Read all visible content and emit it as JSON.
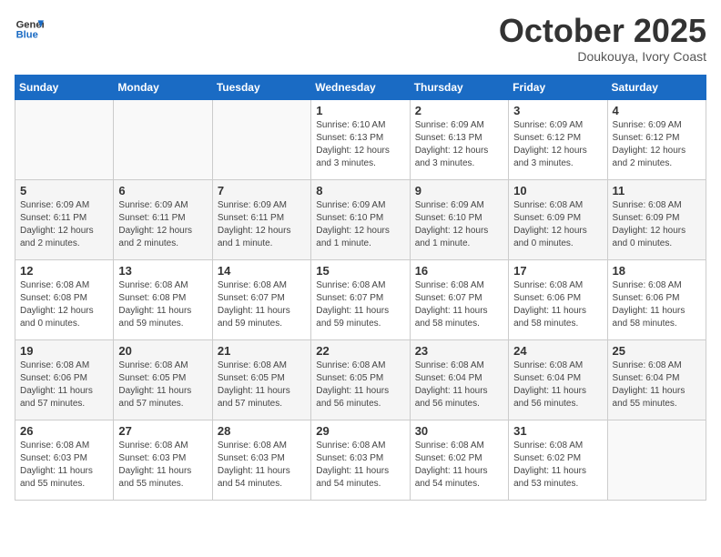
{
  "header": {
    "logo_line1": "General",
    "logo_line2": "Blue",
    "month": "October 2025",
    "location": "Doukouya, Ivory Coast"
  },
  "weekdays": [
    "Sunday",
    "Monday",
    "Tuesday",
    "Wednesday",
    "Thursday",
    "Friday",
    "Saturday"
  ],
  "weeks": [
    [
      {
        "day": "",
        "info": ""
      },
      {
        "day": "",
        "info": ""
      },
      {
        "day": "",
        "info": ""
      },
      {
        "day": "1",
        "info": "Sunrise: 6:10 AM\nSunset: 6:13 PM\nDaylight: 12 hours\nand 3 minutes."
      },
      {
        "day": "2",
        "info": "Sunrise: 6:09 AM\nSunset: 6:13 PM\nDaylight: 12 hours\nand 3 minutes."
      },
      {
        "day": "3",
        "info": "Sunrise: 6:09 AM\nSunset: 6:12 PM\nDaylight: 12 hours\nand 3 minutes."
      },
      {
        "day": "4",
        "info": "Sunrise: 6:09 AM\nSunset: 6:12 PM\nDaylight: 12 hours\nand 2 minutes."
      }
    ],
    [
      {
        "day": "5",
        "info": "Sunrise: 6:09 AM\nSunset: 6:11 PM\nDaylight: 12 hours\nand 2 minutes."
      },
      {
        "day": "6",
        "info": "Sunrise: 6:09 AM\nSunset: 6:11 PM\nDaylight: 12 hours\nand 2 minutes."
      },
      {
        "day": "7",
        "info": "Sunrise: 6:09 AM\nSunset: 6:11 PM\nDaylight: 12 hours\nand 1 minute."
      },
      {
        "day": "8",
        "info": "Sunrise: 6:09 AM\nSunset: 6:10 PM\nDaylight: 12 hours\nand 1 minute."
      },
      {
        "day": "9",
        "info": "Sunrise: 6:09 AM\nSunset: 6:10 PM\nDaylight: 12 hours\nand 1 minute."
      },
      {
        "day": "10",
        "info": "Sunrise: 6:08 AM\nSunset: 6:09 PM\nDaylight: 12 hours\nand 0 minutes."
      },
      {
        "day": "11",
        "info": "Sunrise: 6:08 AM\nSunset: 6:09 PM\nDaylight: 12 hours\nand 0 minutes."
      }
    ],
    [
      {
        "day": "12",
        "info": "Sunrise: 6:08 AM\nSunset: 6:08 PM\nDaylight: 12 hours\nand 0 minutes."
      },
      {
        "day": "13",
        "info": "Sunrise: 6:08 AM\nSunset: 6:08 PM\nDaylight: 11 hours\nand 59 minutes."
      },
      {
        "day": "14",
        "info": "Sunrise: 6:08 AM\nSunset: 6:07 PM\nDaylight: 11 hours\nand 59 minutes."
      },
      {
        "day": "15",
        "info": "Sunrise: 6:08 AM\nSunset: 6:07 PM\nDaylight: 11 hours\nand 59 minutes."
      },
      {
        "day": "16",
        "info": "Sunrise: 6:08 AM\nSunset: 6:07 PM\nDaylight: 11 hours\nand 58 minutes."
      },
      {
        "day": "17",
        "info": "Sunrise: 6:08 AM\nSunset: 6:06 PM\nDaylight: 11 hours\nand 58 minutes."
      },
      {
        "day": "18",
        "info": "Sunrise: 6:08 AM\nSunset: 6:06 PM\nDaylight: 11 hours\nand 58 minutes."
      }
    ],
    [
      {
        "day": "19",
        "info": "Sunrise: 6:08 AM\nSunset: 6:06 PM\nDaylight: 11 hours\nand 57 minutes."
      },
      {
        "day": "20",
        "info": "Sunrise: 6:08 AM\nSunset: 6:05 PM\nDaylight: 11 hours\nand 57 minutes."
      },
      {
        "day": "21",
        "info": "Sunrise: 6:08 AM\nSunset: 6:05 PM\nDaylight: 11 hours\nand 57 minutes."
      },
      {
        "day": "22",
        "info": "Sunrise: 6:08 AM\nSunset: 6:05 PM\nDaylight: 11 hours\nand 56 minutes."
      },
      {
        "day": "23",
        "info": "Sunrise: 6:08 AM\nSunset: 6:04 PM\nDaylight: 11 hours\nand 56 minutes."
      },
      {
        "day": "24",
        "info": "Sunrise: 6:08 AM\nSunset: 6:04 PM\nDaylight: 11 hours\nand 56 minutes."
      },
      {
        "day": "25",
        "info": "Sunrise: 6:08 AM\nSunset: 6:04 PM\nDaylight: 11 hours\nand 55 minutes."
      }
    ],
    [
      {
        "day": "26",
        "info": "Sunrise: 6:08 AM\nSunset: 6:03 PM\nDaylight: 11 hours\nand 55 minutes."
      },
      {
        "day": "27",
        "info": "Sunrise: 6:08 AM\nSunset: 6:03 PM\nDaylight: 11 hours\nand 55 minutes."
      },
      {
        "day": "28",
        "info": "Sunrise: 6:08 AM\nSunset: 6:03 PM\nDaylight: 11 hours\nand 54 minutes."
      },
      {
        "day": "29",
        "info": "Sunrise: 6:08 AM\nSunset: 6:03 PM\nDaylight: 11 hours\nand 54 minutes."
      },
      {
        "day": "30",
        "info": "Sunrise: 6:08 AM\nSunset: 6:02 PM\nDaylight: 11 hours\nand 54 minutes."
      },
      {
        "day": "31",
        "info": "Sunrise: 6:08 AM\nSunset: 6:02 PM\nDaylight: 11 hours\nand 53 minutes."
      },
      {
        "day": "",
        "info": ""
      }
    ]
  ]
}
